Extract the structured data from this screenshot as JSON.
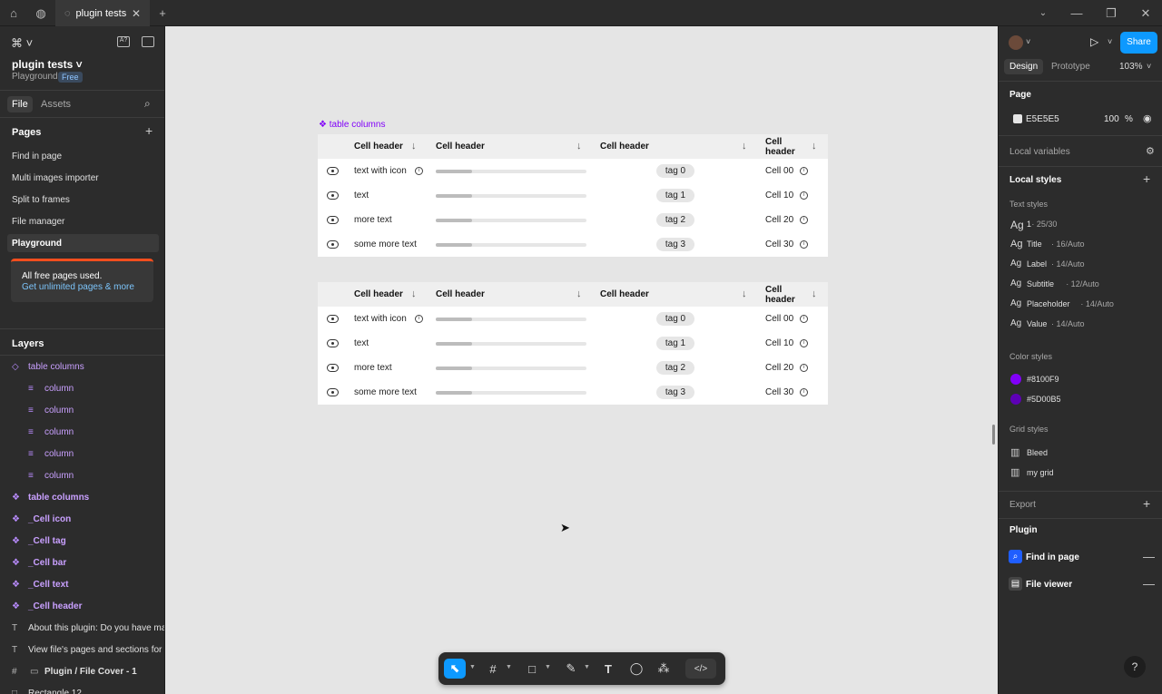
{
  "tabs": {
    "active": "plugin tests"
  },
  "file": {
    "name": "plugin tests",
    "team": "Playground",
    "plan": "Free"
  },
  "left_tabs": {
    "file": "File",
    "assets": "Assets"
  },
  "pages": {
    "title": "Pages",
    "items": [
      "Find in page",
      "Multi images importer",
      "Split to frames",
      "File manager",
      "Playground"
    ]
  },
  "banner": {
    "line1": "All free pages used.",
    "link": "Get unlimited pages & more"
  },
  "layers": {
    "title": "Layers",
    "items": [
      {
        "name": "table columns",
        "indent": 0,
        "kind": "component",
        "bold": false
      },
      {
        "name": "column",
        "indent": 1,
        "kind": "auto",
        "bold": false
      },
      {
        "name": "column",
        "indent": 1,
        "kind": "auto",
        "bold": false
      },
      {
        "name": "column",
        "indent": 1,
        "kind": "auto",
        "bold": false
      },
      {
        "name": "column",
        "indent": 1,
        "kind": "auto",
        "bold": false
      },
      {
        "name": "column",
        "indent": 1,
        "kind": "auto",
        "bold": false
      },
      {
        "name": "table columns",
        "indent": 0,
        "kind": "component",
        "bold": true
      },
      {
        "name": "_Cell icon",
        "indent": 0,
        "kind": "component",
        "bold": true
      },
      {
        "name": "_Cell tag",
        "indent": 0,
        "kind": "component",
        "bold": true
      },
      {
        "name": "_Cell bar",
        "indent": 0,
        "kind": "component",
        "bold": true
      },
      {
        "name": "_Cell text",
        "indent": 0,
        "kind": "component",
        "bold": true
      },
      {
        "name": "_Cell header",
        "indent": 0,
        "kind": "component",
        "bold": true
      },
      {
        "name": "About this plugin: Do you have ma...",
        "indent": 0,
        "kind": "text",
        "bold": false
      },
      {
        "name": "View file's pages and sections for ...",
        "indent": 0,
        "kind": "text",
        "bold": false
      },
      {
        "name": "Plugin / File Cover - 1",
        "indent": 0,
        "kind": "frame",
        "bold": true
      },
      {
        "name": "Rectangle 12",
        "indent": 0,
        "kind": "rect",
        "bold": false
      }
    ]
  },
  "canvas": {
    "frame_label": "table columns",
    "headers": [
      "Cell header",
      "Cell header",
      "Cell header",
      "Cell header"
    ],
    "rows": [
      {
        "text": "text with icon",
        "has_icon": true,
        "progress": 0.24,
        "tag": "tag 0",
        "cell": "Cell 00"
      },
      {
        "text": "text",
        "has_icon": false,
        "progress": 0.24,
        "tag": "tag 1",
        "cell": "Cell 10"
      },
      {
        "text": "more text",
        "has_icon": false,
        "progress": 0.24,
        "tag": "tag 2",
        "cell": "Cell 20"
      },
      {
        "text": "some more text",
        "has_icon": false,
        "progress": 0.24,
        "tag": "tag 3",
        "cell": "Cell 30"
      }
    ]
  },
  "right": {
    "share": "Share",
    "tabs": {
      "design": "Design",
      "prototype": "Prototype"
    },
    "zoom": "103%",
    "page": {
      "title": "Page",
      "color": "E5E5E5",
      "opacity": "100",
      "pct": "%"
    },
    "local_variables": "Local variables",
    "local_styles": "Local styles",
    "text_styles": {
      "title": "Text styles",
      "items": [
        {
          "name": "1",
          "spec": " · 25/30"
        },
        {
          "name": "Title",
          "spec": " · 16/Auto"
        },
        {
          "name": "Label",
          "spec": " · 14/Auto"
        },
        {
          "name": "Subtitle",
          "spec": " · 12/Auto"
        },
        {
          "name": "Placeholder",
          "spec": " · 14/Auto"
        },
        {
          "name": "Value",
          "spec": " · 14/Auto"
        }
      ]
    },
    "color_styles": {
      "title": "Color styles",
      "items": [
        {
          "name": "#8100F9",
          "color": "#8100F9"
        },
        {
          "name": "#5D00B5",
          "color": "#5D00B5"
        }
      ]
    },
    "grid_styles": {
      "title": "Grid styles",
      "items": [
        "Bleed",
        "my grid"
      ]
    },
    "export": "Export",
    "plugin": {
      "title": "Plugin",
      "items": [
        "Find in page",
        "File viewer"
      ]
    }
  },
  "colors": {
    "accent": "#0d99ff",
    "purple": "#8100F9"
  }
}
